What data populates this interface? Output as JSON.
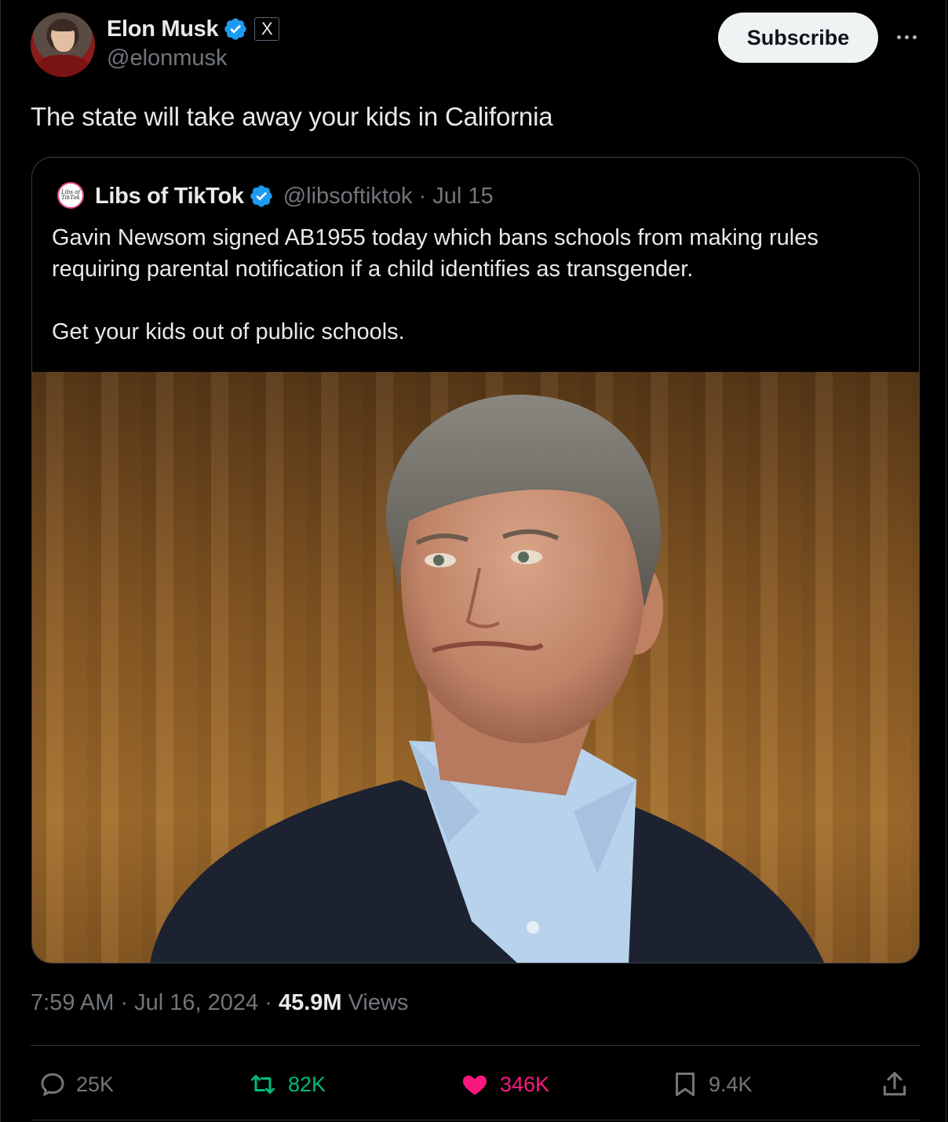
{
  "header": {
    "display_name": "Elon Musk",
    "handle": "@elonmusk",
    "affiliation_badge": "X",
    "subscribe_label": "Subscribe",
    "verified_color": "#1d9bf0"
  },
  "tweet": {
    "text": "The state will take away your kids in California"
  },
  "quote": {
    "display_name": "Libs of TikTok",
    "handle_date": "@libsoftiktok · Jul 15",
    "avatar_text": "Libs of TikTok",
    "paragraph1": "Gavin Newsom signed AB1955 today which bans schools from making rules requiring parental notification if a child identifies as transgender.",
    "paragraph2": "Get your kids out of public schools."
  },
  "meta": {
    "time_date": "7:59 AM · Jul 16, 2024 · ",
    "views_count": "45.9M",
    "views_label": "Views"
  },
  "actions": {
    "replies": "25K",
    "reposts": "82K",
    "likes": "346K",
    "bookmarks": "9.4K"
  },
  "colors": {
    "background": "#000000",
    "text_primary": "#e7e9ea",
    "text_secondary": "#71767b",
    "repost_green": "#00ba7c",
    "like_pink": "#f91880"
  }
}
